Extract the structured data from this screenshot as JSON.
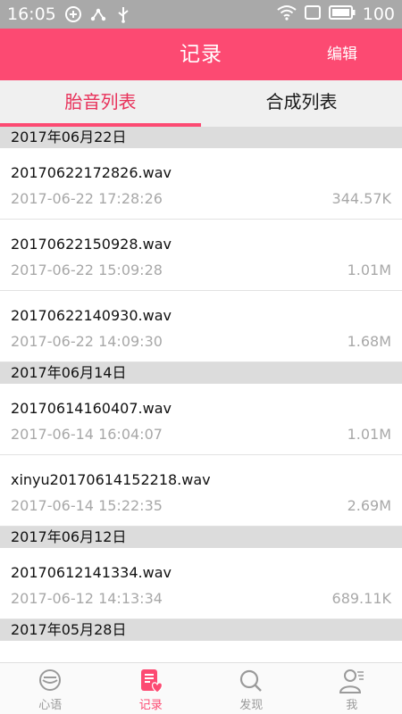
{
  "status_bar": {
    "time": "16:05",
    "battery": "100"
  },
  "app_bar": {
    "title": "记录",
    "edit_label": "编辑"
  },
  "tabs": [
    {
      "label": "胎音列表",
      "active": true
    },
    {
      "label": "合成列表",
      "active": false
    }
  ],
  "groups": [
    {
      "date": "2017年06月22日",
      "items": [
        {
          "name": "20170622172826.wav",
          "time": "2017-06-22 17:28:26",
          "size": "344.57K"
        },
        {
          "name": "20170622150928.wav",
          "time": "2017-06-22 15:09:28",
          "size": "1.01M"
        },
        {
          "name": "20170622140930.wav",
          "time": "2017-06-22 14:09:30",
          "size": "1.68M"
        }
      ]
    },
    {
      "date": "2017年06月14日",
      "items": [
        {
          "name": "20170614160407.wav",
          "time": "2017-06-14 16:04:07",
          "size": "1.01M"
        },
        {
          "name": "xinyu20170614152218.wav",
          "time": "2017-06-14 15:22:35",
          "size": "2.69M"
        }
      ]
    },
    {
      "date": "2017年06月12日",
      "items": [
        {
          "name": "20170612141334.wav",
          "time": "2017-06-12 14:13:34",
          "size": "689.11K"
        }
      ]
    },
    {
      "date": "2017年05月28日",
      "items": []
    }
  ],
  "bottom_nav": [
    {
      "label": "心语",
      "icon": "heart-speech-icon",
      "active": false
    },
    {
      "label": "记录",
      "icon": "record-icon",
      "active": true
    },
    {
      "label": "发现",
      "icon": "search-icon",
      "active": false
    },
    {
      "label": "我",
      "icon": "user-icon",
      "active": false
    }
  ],
  "colors": {
    "accent": "#fc4a72",
    "status_bar": "#a9a9a9",
    "tab_active_text": "#e8315a"
  }
}
